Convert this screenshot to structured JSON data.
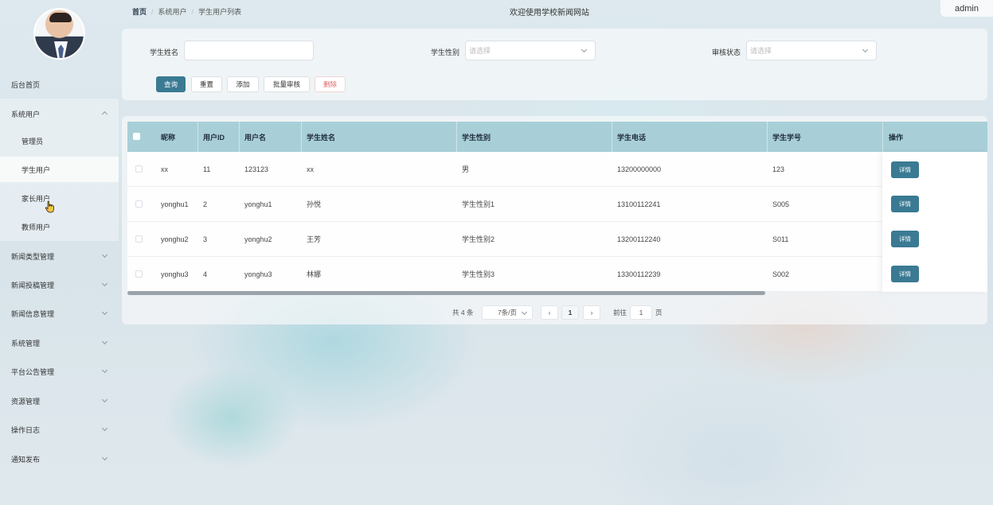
{
  "header": {
    "breadcrumb": [
      "首页",
      "系统用户",
      "学生用户列表"
    ],
    "site_title": "欢迎使用学校新闻网站",
    "user": "admin"
  },
  "sidebar": {
    "home": "后台首页",
    "groups": [
      {
        "label": "系统用户",
        "expanded": true,
        "children": [
          "管理员",
          "学生用户",
          "家长用户",
          "教师用户"
        ],
        "active_child": "学生用户"
      },
      {
        "label": "新闻类型管理"
      },
      {
        "label": "新闻投稿管理"
      },
      {
        "label": "新闻信息管理"
      },
      {
        "label": "系统管理"
      },
      {
        "label": "平台公告管理"
      },
      {
        "label": "资源管理"
      },
      {
        "label": "操作日志"
      },
      {
        "label": "通知发布"
      }
    ]
  },
  "search": {
    "name_label": "学生姓名",
    "name_value": "",
    "gender_label": "学生性别",
    "gender_placeholder": "请选择",
    "status_label": "审核状态",
    "status_placeholder": "请选择"
  },
  "actions": {
    "query": "查询",
    "reset": "重置",
    "add": "添加",
    "batch_review": "批量审核",
    "delete": "删除"
  },
  "table": {
    "columns": [
      "昵称",
      "用户ID",
      "用户名",
      "学生姓名",
      "学生性别",
      "学生电话",
      "学生学号",
      "操作"
    ],
    "rows": [
      {
        "nickname": "xx",
        "id": "11",
        "username": "123123",
        "name": "xx",
        "gender": "男",
        "phone": "13200000000",
        "student_no": "123",
        "op": "详情"
      },
      {
        "nickname": "yonghu1",
        "id": "2",
        "username": "yonghu1",
        "name": "孙悦",
        "gender": "学生性别1",
        "phone": "13100112241",
        "student_no": "S005",
        "op": "详情"
      },
      {
        "nickname": "yonghu2",
        "id": "3",
        "username": "yonghu2",
        "name": "王芳",
        "gender": "学生性别2",
        "phone": "13200112240",
        "student_no": "S011",
        "op": "详情"
      },
      {
        "nickname": "yonghu3",
        "id": "4",
        "username": "yonghu3",
        "name": "林娜",
        "gender": "学生性别3",
        "phone": "13300112239",
        "student_no": "S002",
        "op": "详情"
      }
    ]
  },
  "pagination": {
    "total": "共 4 条",
    "page_size": "7条/页",
    "current": "1",
    "goto_label": "前往",
    "goto_value": "1",
    "page_suffix": "页"
  },
  "colors": {
    "primary": "#3a7a93",
    "table_header": "#a8cfd8",
    "danger_text": "#e06767"
  }
}
